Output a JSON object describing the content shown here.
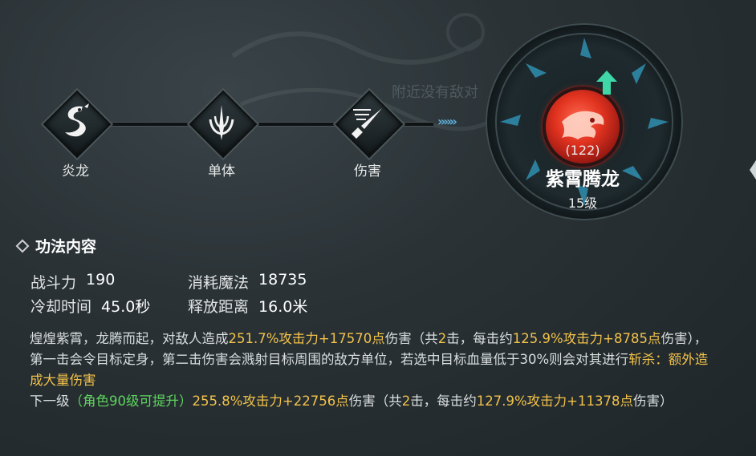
{
  "background": {
    "faint_texts": [
      "附近没有敌对"
    ]
  },
  "flow": {
    "nodes": [
      {
        "label": "炎龙",
        "icon": "dragon-icon"
      },
      {
        "label": "单体",
        "icon": "single-target-icon"
      },
      {
        "label": "伤害",
        "icon": "sword-damage-icon"
      }
    ],
    "arrow_glyph": "»»»"
  },
  "skill": {
    "count": "(122)",
    "name": "紫霄腾龙",
    "level": "15级",
    "upgrade_icon": "up-arrow-icon"
  },
  "section": {
    "title": "功法内容"
  },
  "stats": {
    "combat_power_label": "战斗力",
    "combat_power_value": "190",
    "mana_cost_label": "消耗魔法",
    "mana_cost_value": "18735",
    "cooldown_label": "冷却时间",
    "cooldown_value": "45.0秒",
    "range_label": "释放距离",
    "range_value": "16.0米"
  },
  "description": {
    "p1_a": "煌煌紫霄，龙腾而起，对敌人造成",
    "p1_b": "251.7%攻击力+17570点",
    "p1_c": "伤害（共",
    "p1_d": "2",
    "p1_e": "击，每击约",
    "p1_f": "125.9%攻击力+8785点",
    "p1_g": "伤害），第一击会令目标定身，第二击伤害会溅射目标周围的敌方单位，若选中目标血量低于30%则会对其进行",
    "p1_h": "斩杀：额外造成大量伤害",
    "p2_a": "下一级",
    "p2_b": "（角色90级可提升）",
    "p2_c": "255.8%攻击力+22756点",
    "p2_d": "伤害（共",
    "p2_e": "2",
    "p2_f": "击，每击约",
    "p2_g": "127.9%攻击力+11378点",
    "p2_h": "伤害）"
  },
  "colors": {
    "highlight_yellow": "#f2c24a",
    "highlight_green": "#5fd45f",
    "arrow_blue": "#5fb0d8"
  }
}
